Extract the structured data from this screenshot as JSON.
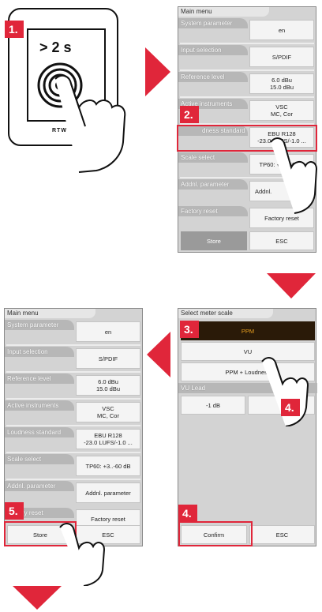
{
  "steps": {
    "s1": "1.",
    "s2": "2.",
    "s3": "3.",
    "s4": "4.",
    "s4b": "4.",
    "s5": "5."
  },
  "device": {
    "press_label": "> 2 s",
    "brand": "RTW"
  },
  "screen1": {
    "title": "Main menu",
    "rows": [
      {
        "label": "System parameter",
        "value": "en"
      },
      {
        "label": "Input selection",
        "value": "S/PDIF"
      },
      {
        "label": "Reference level",
        "value": "6.0 dBu\n15.0 dBu"
      },
      {
        "label": "Active instruments",
        "value": "VSC\nMC, Cor"
      },
      {
        "label": "dness standard",
        "value": "EBU R128\n-23.0 LUFS/-1.0 ..."
      },
      {
        "label": "Scale select",
        "value": "TP60: +3..-60 dB"
      },
      {
        "label": "Addnl. parameter",
        "value": "Addnl."
      },
      {
        "label": "Factory reset",
        "value": "Factory reset"
      }
    ],
    "store": "Store",
    "esc": "ESC"
  },
  "screen2": {
    "title": "Select meter scale",
    "ppm": "PPM",
    "vu": "VU",
    "ppm_loudness": "PPM + Loudness",
    "vu_lead_label": "VU Lead",
    "vu_lead_value": "-1 dB",
    "confirm": "Confirm",
    "esc": "ESC"
  },
  "screen3": {
    "title": "Main menu",
    "rows": [
      {
        "label": "System parameter",
        "value": "en"
      },
      {
        "label": "Input selection",
        "value": "S/PDIF"
      },
      {
        "label": "Reference level",
        "value": "6.0 dBu\n15.0 dBu"
      },
      {
        "label": "Active instruments",
        "value": "VSC\nMC, Cor"
      },
      {
        "label": "Loudness standard",
        "value": "EBU R128\n-23.0 LUFS/-1.0 ..."
      },
      {
        "label": "Scale select",
        "value": "TP60: +3..-60 dB"
      },
      {
        "label": "Addnl. parameter",
        "value": "Addnl. parameter"
      },
      {
        "label": "ry reset",
        "value": "Factory reset"
      }
    ],
    "store": "Store",
    "esc": "ESC"
  },
  "colors": {
    "accent": "#e0263a",
    "ppm_selected": "#2a1a08",
    "ppm_text": "#e8a020"
  }
}
